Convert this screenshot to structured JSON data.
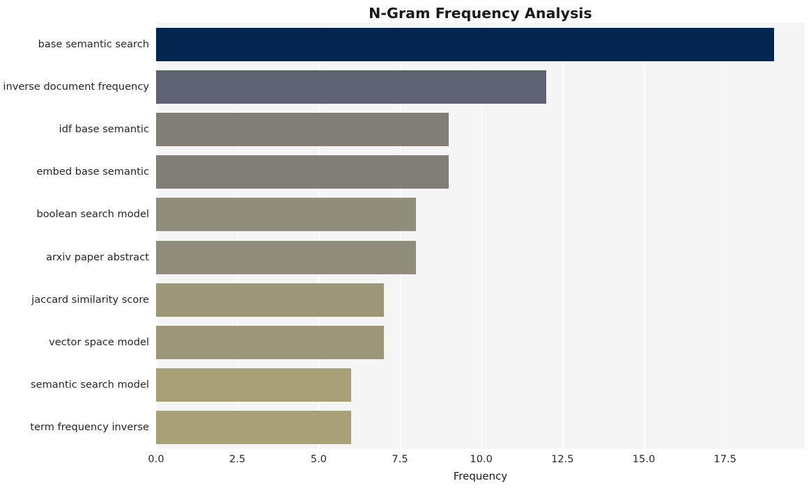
{
  "chart_data": {
    "type": "bar",
    "orientation": "horizontal",
    "title": "N-Gram Frequency Analysis",
    "xlabel": "Frequency",
    "ylabel": "",
    "categories": [
      "base semantic search",
      "inverse document frequency",
      "idf base semantic",
      "embed base semantic",
      "boolean search model",
      "arxiv paper abstract",
      "jaccard similarity score",
      "vector space model",
      "semantic search model",
      "term frequency inverse"
    ],
    "values": [
      19,
      12,
      9,
      9,
      8,
      8,
      7,
      7,
      6,
      6
    ],
    "bar_colors": [
      "#042550",
      "#5e6272",
      "#817e78",
      "#817e78",
      "#918d7c",
      "#918d7c",
      "#9b9778",
      "#9b9778",
      "#a8a076",
      "#a8a076"
    ],
    "xlim": [
      0,
      19.95
    ],
    "xticks": [
      0.0,
      2.5,
      5.0,
      7.5,
      10.0,
      12.5,
      15.0,
      17.5
    ],
    "xticklabels": [
      "0.0",
      "2.5",
      "5.0",
      "7.5",
      "10.0",
      "12.5",
      "15.0",
      "17.5"
    ],
    "grid": true,
    "grid_axis": "x",
    "grid_color": "#ffffff",
    "plot_background": "#f5f5f6",
    "figure_background": "#ffffff",
    "legend": null
  }
}
